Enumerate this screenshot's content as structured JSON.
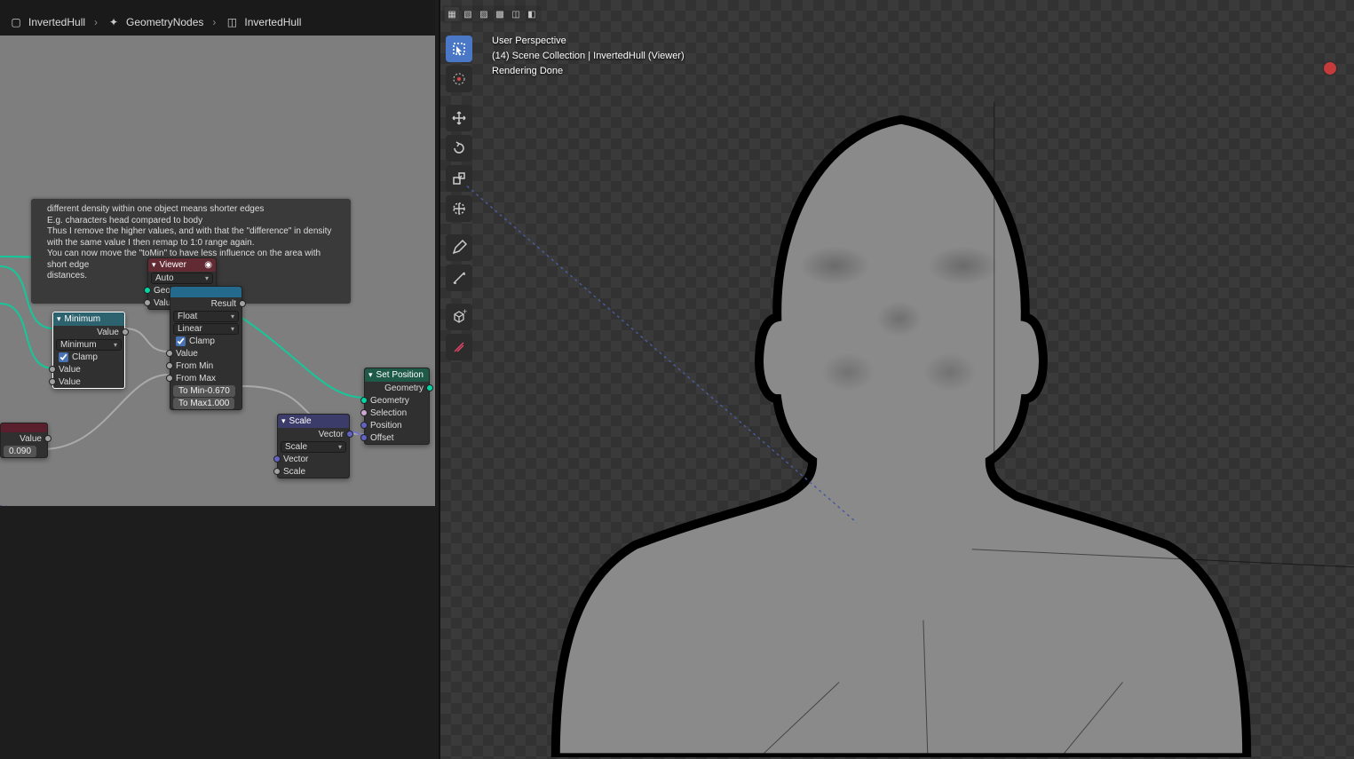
{
  "breadcrumb": {
    "items": [
      {
        "label": "InvertedHull"
      },
      {
        "label": "GeometryNodes"
      },
      {
        "label": "InvertedHull"
      }
    ]
  },
  "frame": {
    "text0": "different density within one object means shorter edges",
    "text1": "E.g. characters head compared to body",
    "text2": "Thus I remove the higher values, and with that the \"difference\" in density",
    "text3": "with the same value I then remap to 1:0 range again.",
    "text4": "You can now move the \"toMin\" to have less influence on the area with short edge",
    "text5": "distances."
  },
  "nodes": {
    "viewer": {
      "title": "Viewer",
      "auto": "Auto",
      "geometry": "Geometry",
      "value": "Value"
    },
    "minimum": {
      "title": "Minimum",
      "out_value": "Value",
      "op": "Minimum",
      "clamp": "Clamp",
      "in_val1": "Value",
      "in_val2": "Value"
    },
    "maprange": {
      "title": "",
      "result": "Result",
      "type": "Float",
      "interp": "Linear",
      "clamp": "Clamp",
      "value": "Value",
      "frommin": "From Min",
      "frommax": "From Max",
      "tomin_l": "To Min",
      "tomin_v": "-0.670",
      "tomax_l": "To Max",
      "tomax_v": "1.000"
    },
    "scale": {
      "title": "Scale",
      "out_vec": "Vector",
      "op": "Scale",
      "in_vec": "Vector",
      "in_scale": "Scale"
    },
    "setpos": {
      "title": "Set Position",
      "out_geo": "Geometry",
      "in_geo": "Geometry",
      "in_sel": "Selection",
      "in_pos": "Position",
      "in_off": "Offset"
    },
    "small": {
      "title": "",
      "out_value": "Value",
      "num": "0.090"
    }
  },
  "viewport": {
    "line0": "User Perspective",
    "line1": "(14) Scene Collection | InvertedHull (Viewer)",
    "line2": "Rendering Done"
  }
}
